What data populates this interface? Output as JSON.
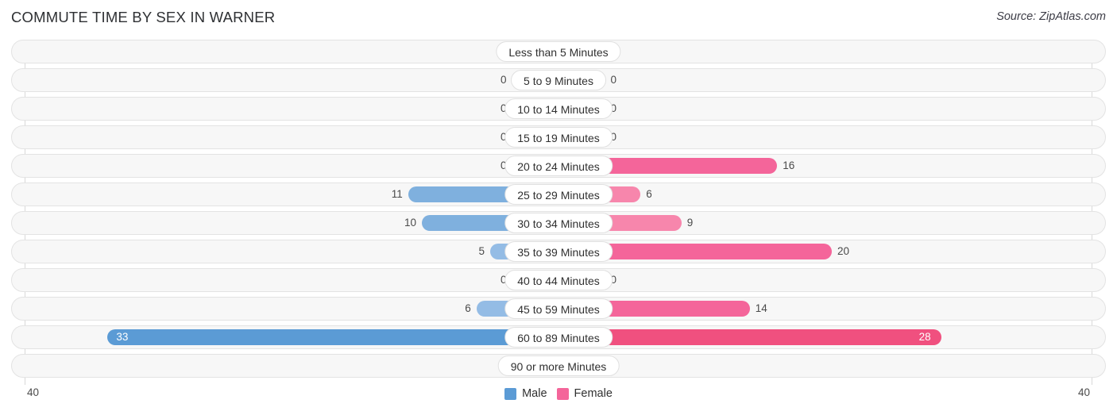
{
  "header": {
    "title": "COMMUTE TIME BY SEX IN WARNER",
    "source": "Source: ZipAtlas.com"
  },
  "axis": {
    "left_label": "40",
    "right_label": "40",
    "max": 40
  },
  "legend": {
    "items": [
      {
        "label": "Male",
        "color": "#5b9bd5"
      },
      {
        "label": "Female",
        "color": "#f4659a"
      }
    ]
  },
  "colors": {
    "male_strong": "#5b9bd5",
    "male_mid": "#89b6e3",
    "male_light": "#aec9ec",
    "female_strong": "#f0507f",
    "female_mid": "#f4739f",
    "female_light": "#f8aecb",
    "track_bg": "#f7f7f7",
    "track_border": "#e3e3e3",
    "gridline": "#d8d8d8"
  },
  "chart_data": {
    "type": "bar",
    "title": "COMMUTE TIME BY SEX IN WARNER",
    "subtitle": "",
    "xlabel": "",
    "ylabel": "",
    "orientation": "horizontal-diverging",
    "xlim": [
      40,
      40
    ],
    "grid": true,
    "legend_position": "bottom-center",
    "categories": [
      "Less than 5 Minutes",
      "5 to 9 Minutes",
      "10 to 14 Minutes",
      "15 to 19 Minutes",
      "20 to 24 Minutes",
      "25 to 29 Minutes",
      "30 to 34 Minutes",
      "35 to 39 Minutes",
      "40 to 44 Minutes",
      "45 to 59 Minutes",
      "60 to 89 Minutes",
      "90 or more Minutes"
    ],
    "series": [
      {
        "name": "Male",
        "values": [
          0,
          0,
          0,
          0,
          0,
          11,
          10,
          5,
          0,
          6,
          33,
          0
        ]
      },
      {
        "name": "Female",
        "values": [
          0,
          0,
          0,
          0,
          16,
          6,
          9,
          20,
          0,
          14,
          28,
          0
        ]
      }
    ]
  },
  "rows": [
    {
      "category": "Less than 5 Minutes",
      "male": 0,
      "male_text": "0",
      "female": 0,
      "female_text": "0"
    },
    {
      "category": "5 to 9 Minutes",
      "male": 0,
      "male_text": "0",
      "female": 0,
      "female_text": "0"
    },
    {
      "category": "10 to 14 Minutes",
      "male": 0,
      "male_text": "0",
      "female": 0,
      "female_text": "0"
    },
    {
      "category": "15 to 19 Minutes",
      "male": 0,
      "male_text": "0",
      "female": 0,
      "female_text": "0"
    },
    {
      "category": "20 to 24 Minutes",
      "male": 0,
      "male_text": "0",
      "female": 16,
      "female_text": "16"
    },
    {
      "category": "25 to 29 Minutes",
      "male": 11,
      "male_text": "11",
      "female": 6,
      "female_text": "6"
    },
    {
      "category": "30 to 34 Minutes",
      "male": 10,
      "male_text": "10",
      "female": 9,
      "female_text": "9"
    },
    {
      "category": "35 to 39 Minutes",
      "male": 5,
      "male_text": "5",
      "female": 20,
      "female_text": "20"
    },
    {
      "category": "40 to 44 Minutes",
      "male": 0,
      "male_text": "0",
      "female": 0,
      "female_text": "0"
    },
    {
      "category": "45 to 59 Minutes",
      "male": 6,
      "male_text": "6",
      "female": 14,
      "female_text": "14"
    },
    {
      "category": "60 to 89 Minutes",
      "male": 33,
      "male_text": "33",
      "female": 28,
      "female_text": "28"
    },
    {
      "category": "90 or more Minutes",
      "male": 0,
      "male_text": "0",
      "female": 0,
      "female_text": "0"
    }
  ]
}
